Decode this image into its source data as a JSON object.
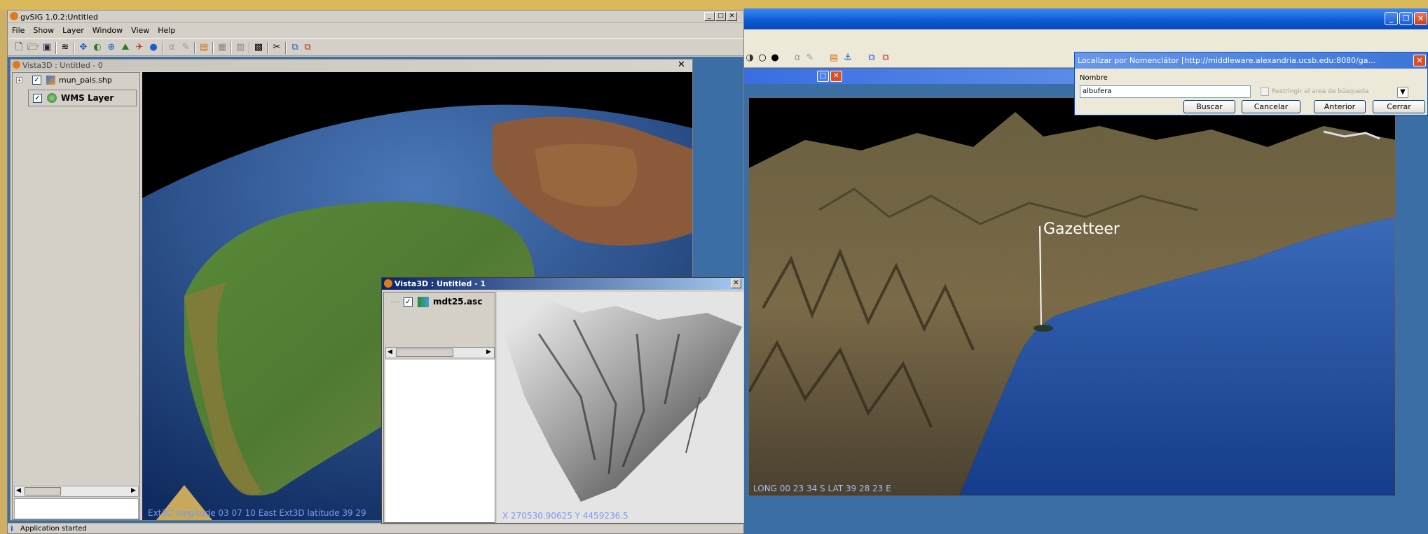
{
  "main_window": {
    "title": "gvSIG 1.0.2:Untitled",
    "menu": [
      "File",
      "Show",
      "Layer",
      "Window",
      "View",
      "Help"
    ],
    "status": "Application started"
  },
  "view0": {
    "title": "Vista3D : Untitled - 0",
    "layers": [
      "mun_pais.shp",
      "WMS Layer"
    ],
    "readout": "Ext3D longitude 03 07 10 East Ext3D latitude 39 29"
  },
  "view1": {
    "title": "Vista3D : Untitled - 1",
    "layers": [
      "mdt25.asc"
    ],
    "readout": "X 270530.90625  Y 4459236.5"
  },
  "right_view": {
    "readout": "LONG 00 23 34 S LAT 39 28 23 E",
    "marker_label": "Gazetteer"
  },
  "gazetteer": {
    "title": "Localizar por Nomenclátor [http://middleware.alexandria.ucsb.edu:8080/ga...",
    "name_label": "Nombre",
    "name_value": "albufera",
    "restrict_label": "Restringir el area de búsqueda",
    "buttons": [
      "Buscar",
      "Cancelar",
      "Anterior",
      "Cerrar"
    ]
  },
  "icons": {
    "window_controls": [
      "minimize-icon",
      "maximize-icon",
      "close-icon"
    ],
    "toolbar": [
      "new-doc-icon",
      "open-icon",
      "save-icon",
      "layers-icon",
      "pan-icon",
      "zoom-icon",
      "globe-icon",
      "info-icon"
    ]
  }
}
